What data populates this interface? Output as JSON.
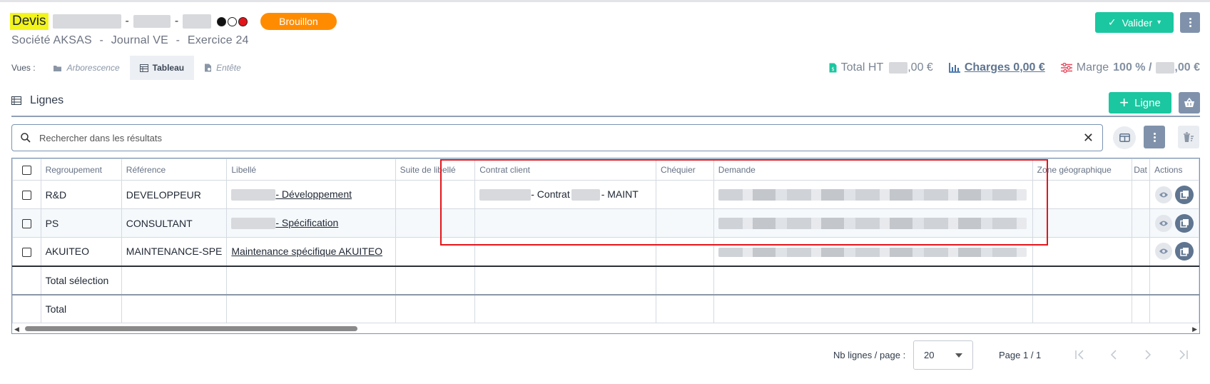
{
  "header": {
    "doc_type": "Devis",
    "badge": "Brouillon",
    "subtitle": [
      "Société AKSAS",
      "-",
      "Journal VE",
      "-",
      "Exercice 24"
    ],
    "valider_label": "Valider",
    "caret": "▾"
  },
  "views": {
    "label": "Vues :",
    "items": [
      {
        "label": "Arborescence",
        "active": false
      },
      {
        "label": "Tableau",
        "active": true
      },
      {
        "label": "Entête",
        "active": false
      }
    ]
  },
  "totals": {
    "total_ht_label": "Total HT",
    "total_ht_suffix": ",00 €",
    "charges": "Charges 0,00 €",
    "marge_label": "Marge",
    "marge_pct": "100 % /",
    "marge_suffix": ",00 €"
  },
  "section": {
    "title": "Lignes",
    "add_label": "Ligne"
  },
  "search": {
    "placeholder": "Rechercher dans les résultats",
    "clear": "✕"
  },
  "table": {
    "columns": [
      "Regroupement",
      "Référence",
      "Libellé",
      "Suite de libellé",
      "Contrat client",
      "Chéquier",
      "Demande",
      "Zone géographique",
      "Dat",
      "Actions"
    ],
    "rows": [
      {
        "regroupement": "R&D",
        "reference": "DEVELOPPEUR",
        "libelle": "- Développement",
        "contrat_mid": "- Contrat",
        "contrat_end": "- MAINT"
      },
      {
        "regroupement": "PS",
        "reference": "CONSULTANT",
        "libelle": "- Spécification",
        "contrat_mid": "",
        "contrat_end": ""
      },
      {
        "regroupement": "AKUITEO",
        "reference": "MAINTENANCE-SPE",
        "libelle": "Maintenance spécifique AKUITEO",
        "contrat_mid": "",
        "contrat_end": ""
      }
    ],
    "total_selection": "Total sélection",
    "total": "Total"
  },
  "pagination": {
    "rows_label": "Nb lignes / page :",
    "rows_value": "20",
    "page_label": "Page 1 / 1"
  },
  "colors": {
    "accent": "#1ac7a0",
    "badge": "#ff8c00",
    "highlight": "#f3f51a",
    "slate": "#8092ab",
    "frame": "#e3151a"
  }
}
